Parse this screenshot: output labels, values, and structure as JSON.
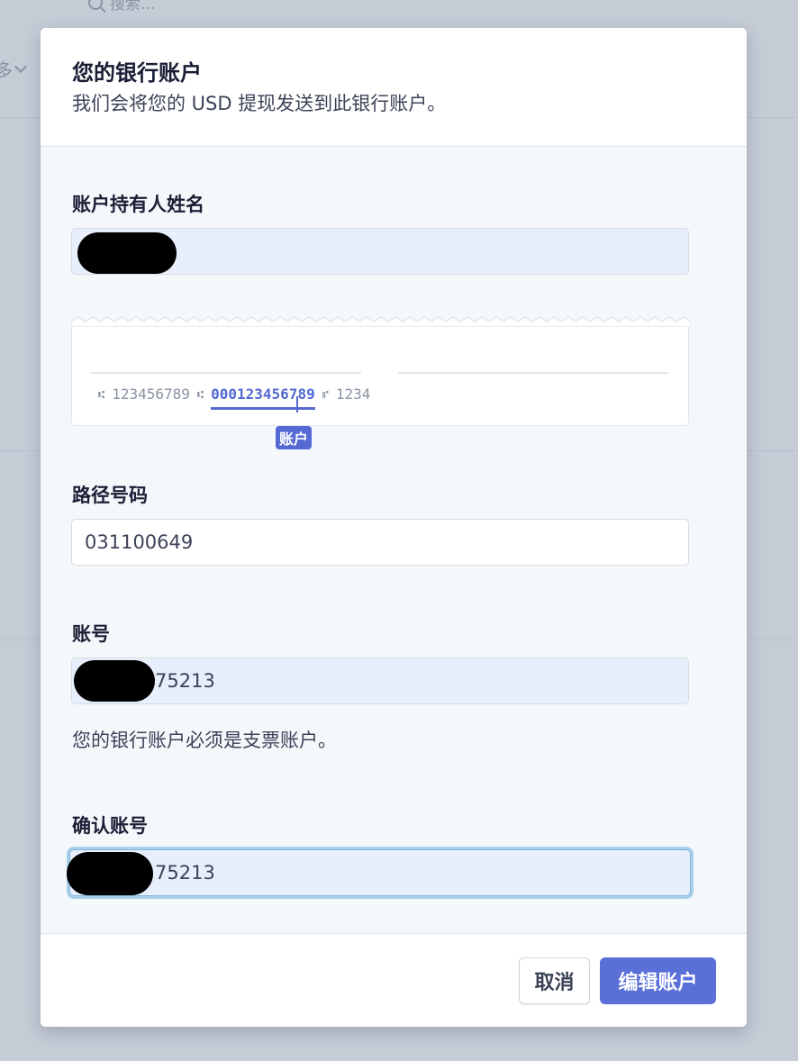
{
  "background": {
    "search_placeholder": "搜索...",
    "more_label": "多"
  },
  "modal": {
    "title": "您的银行账户",
    "subtitle": "我们会将您的 USD 提现发送到此银行账户。",
    "holder_name": {
      "label": "账户持有人姓名",
      "value": ""
    },
    "check_illustration": {
      "routing_sample": "123456789",
      "account_sample": "000123456789",
      "check_sample": "1234",
      "account_tag": "账户"
    },
    "routing": {
      "label": "路径号码",
      "value": "031100649"
    },
    "account_number": {
      "label": "账号",
      "value_visible": "75213",
      "helper": "您的银行账户必须是支票账户。"
    },
    "confirm_account": {
      "label": "确认账号",
      "value_visible": "75213"
    },
    "footer": {
      "cancel_label": "取消",
      "submit_label": "编辑账户"
    }
  },
  "colors": {
    "primary": "#5b6fd8",
    "field_filled": "#e8effc",
    "focus_ring": "#a8d0ea"
  }
}
